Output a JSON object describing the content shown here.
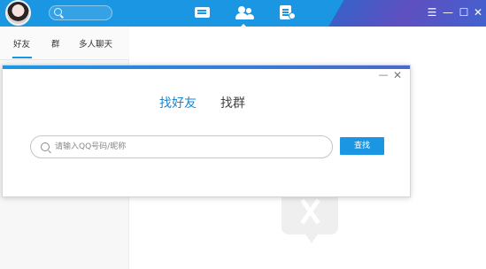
{
  "window": {
    "nav": [
      "message-icon",
      "contacts-icon",
      "space-icon"
    ],
    "controls": {
      "menu": "☰",
      "minimize": "—",
      "maximize": "☐",
      "close": "✕"
    },
    "accent_color": "#1a96e3"
  },
  "sidebar": {
    "tabs": [
      {
        "label": "好友"
      },
      {
        "label": "群"
      },
      {
        "label": "多人聊天"
      }
    ]
  },
  "dialog": {
    "tabs": [
      {
        "label": "找好友",
        "active": true
      },
      {
        "label": "找群",
        "active": false
      }
    ],
    "search": {
      "value": "",
      "placeholder": "请输入QQ号码/昵称"
    },
    "search_button": "查找",
    "minimize": "—",
    "close": "✕"
  }
}
